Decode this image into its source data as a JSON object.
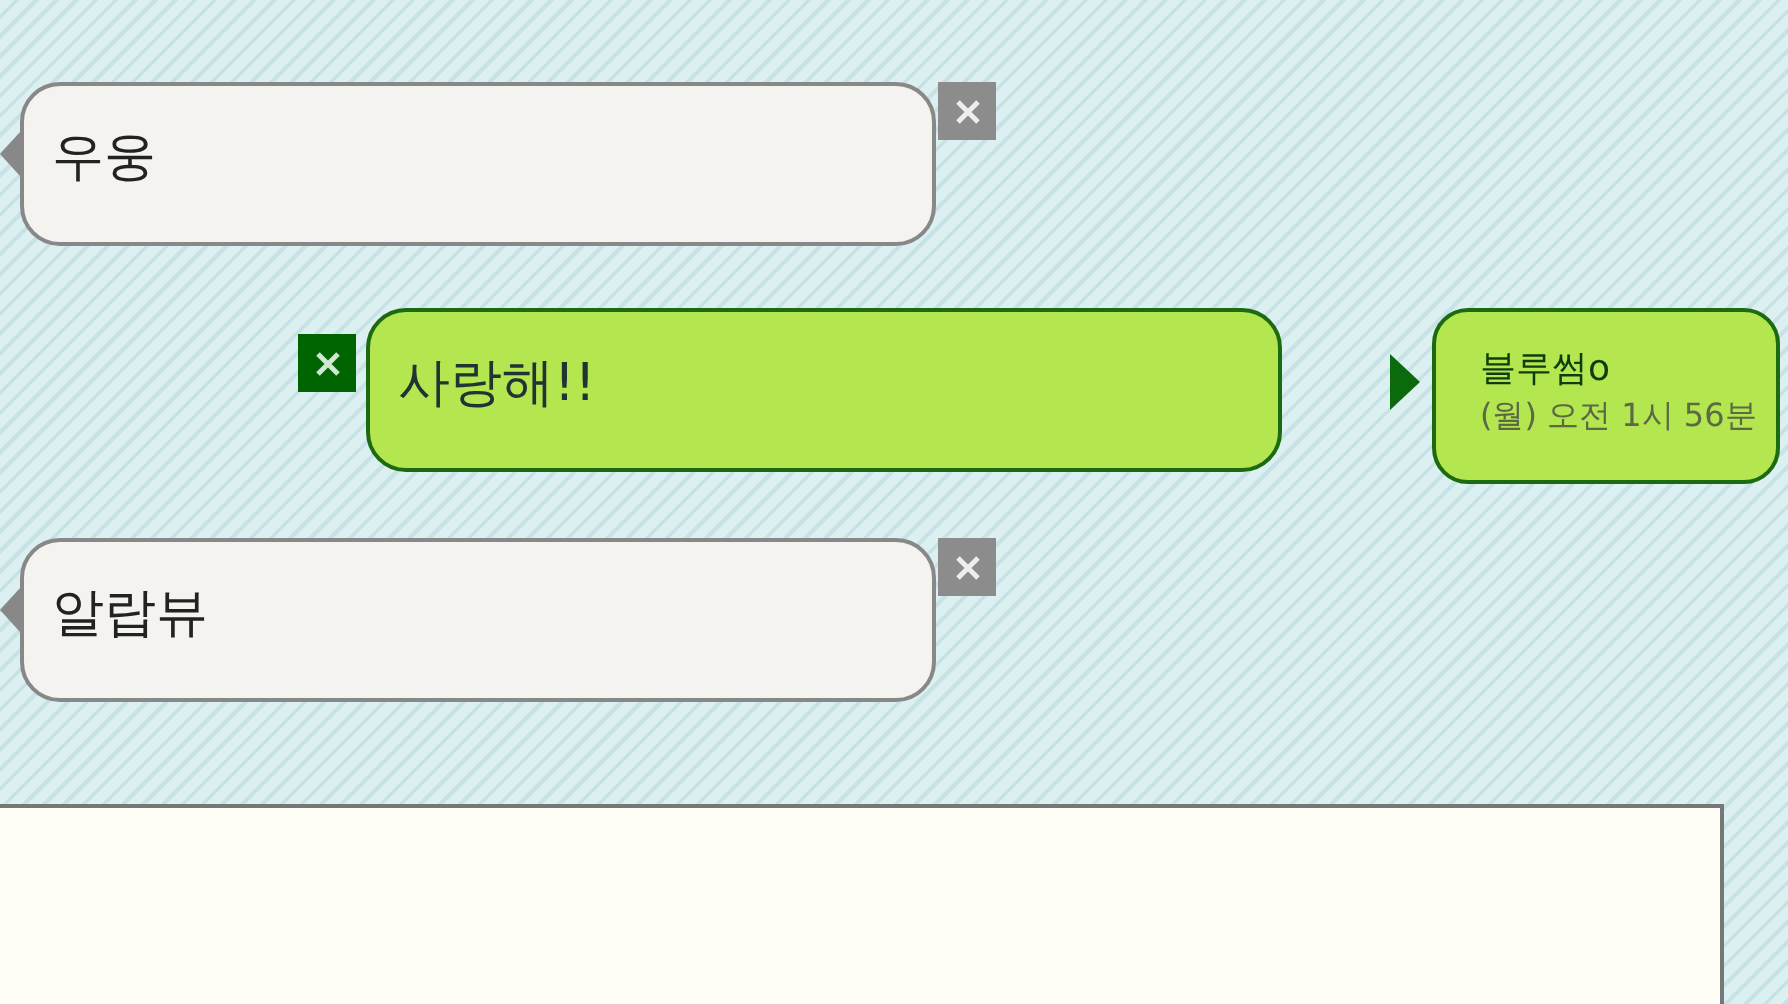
{
  "messages": [
    {
      "kind": "received",
      "text": "우웅"
    },
    {
      "kind": "sent",
      "text": "사랑해!!",
      "sender": "블루썸o",
      "time": "(월) 오전 1시 56분"
    },
    {
      "kind": "received",
      "text": "알랍뷰"
    }
  ]
}
